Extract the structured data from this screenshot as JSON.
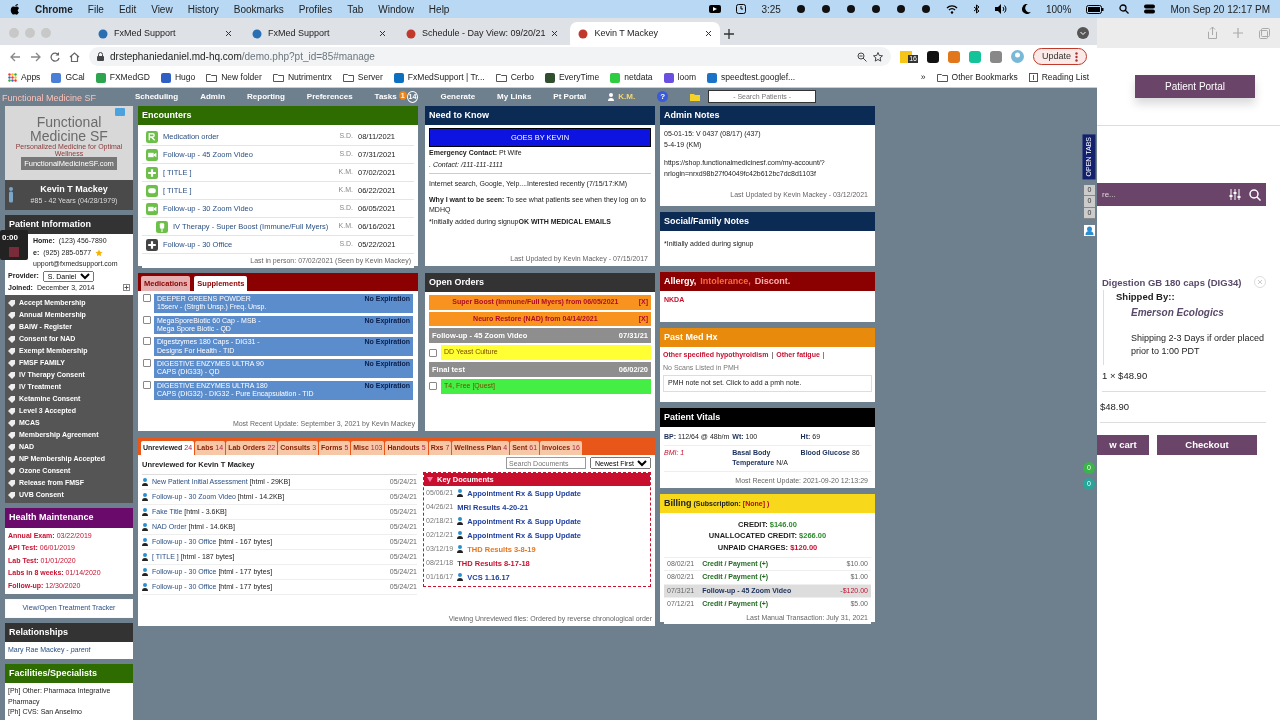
{
  "menubar": {
    "app": "Chrome",
    "menus": [
      "File",
      "Edit",
      "View",
      "History",
      "Bookmarks",
      "Profiles",
      "Tab",
      "Window",
      "Help"
    ],
    "timer": "3:25",
    "battery": "100%",
    "clock": "Mon Sep 20  12:17 PM"
  },
  "browser": {
    "tabs": [
      {
        "title": "FxMed Support",
        "selected": false
      },
      {
        "title": "FxMed Support",
        "selected": false
      },
      {
        "title": "Schedule - Day View: 09/20/21",
        "selected": false
      },
      {
        "title": "Kevin T Mackey",
        "selected": true
      }
    ],
    "address_host": "drstephaniedaniel.md-hq.com",
    "address_path": "/demo.php?pt_id=85#manage",
    "extension_badge": "16",
    "update": "Update",
    "bookmarks": [
      {
        "label": "Apps",
        "kind": "apps"
      },
      {
        "label": "GCal",
        "kind": "site",
        "color": "#4a7fd8"
      },
      {
        "label": "FXMedGD",
        "kind": "site",
        "color": "#2da44e"
      },
      {
        "label": "Hugo",
        "kind": "site",
        "color": "#2f5fc4"
      },
      {
        "label": "New folder",
        "kind": "folder"
      },
      {
        "label": "Nutrimentrx",
        "kind": "folder"
      },
      {
        "label": "Server",
        "kind": "folder"
      },
      {
        "label": "FxMedSupport | Tr...",
        "kind": "site",
        "color": "#0d6fbf"
      },
      {
        "label": "Cerbo",
        "kind": "folder"
      },
      {
        "label": "EveryTime",
        "kind": "site",
        "color": "#2f4f2f"
      },
      {
        "label": "netdata",
        "kind": "site",
        "color": "#2ecc40"
      },
      {
        "label": "loom",
        "kind": "site",
        "color": "#6b4fe0"
      },
      {
        "label": "speedtest.googlef...",
        "kind": "site",
        "color": "#1a73c8"
      }
    ],
    "more": "»",
    "other_bookmarks": "Other Bookmarks",
    "reading_list": "Reading List"
  },
  "app_nav": {
    "logo": "Functional Medicine SF",
    "items": [
      {
        "label": "Scheduling"
      },
      {
        "label": "Admin"
      },
      {
        "label": "Reporting"
      },
      {
        "label": "Preferences"
      },
      {
        "label": "Tasks",
        "badge": "1",
        "count": "14"
      },
      {
        "label": "Generate"
      },
      {
        "label": "My Links"
      },
      {
        "label": "Pt Portal"
      }
    ],
    "user": "K.M.",
    "help": "?",
    "search_placeholder": "- Search Patients -"
  },
  "recorder": {
    "time": "0:00"
  },
  "sidebar": {
    "logo_lines": [
      "Functional",
      "Medicine SF"
    ],
    "tagline": "Personalized Medicine for Optimal Wellness",
    "website": "FunctionalMedicineSF.com",
    "patient_name": "Kevin T Mackey",
    "patient_meta": "#85 - 42 Years (04/28/1979)",
    "info_title": "Patient Information",
    "info": [
      {
        "label": "Home:",
        "value": "(123) 456-7890",
        "starred": false
      },
      {
        "label": "e:",
        "value": "(925) 285-0577",
        "starred": true
      },
      {
        "value": "upport@fxmedsupport.com",
        "starred": false
      }
    ],
    "provider_label": "Provider:",
    "provider": "S. Daniel",
    "joined_label": "Joined:",
    "joined": "December 3, 2014",
    "forms": [
      "Accept Membership",
      "Annual Membership",
      "BAIW - Register",
      "Consent for NAD",
      "Exempt Membership",
      "FMSF FAMILY",
      "IV Therapy Consent",
      "IV Treatment",
      "Ketamine Consent",
      "Level 3 Accepted",
      "MCAS",
      "Membership Agreement",
      "NAD",
      "NP Membership Accepted",
      "Ozone Consent",
      "Release from FMSF",
      "UVB Consent"
    ],
    "health_title": "Health Maintenance",
    "health": [
      {
        "label": "Annual Exam:",
        "value": "03/22/2019"
      },
      {
        "label": "API Test:",
        "value": "06/01/2019"
      },
      {
        "label": "Lab Test:",
        "value": "01/01/2020"
      },
      {
        "label": "Labs in 8 weeks:",
        "value": "01/14/2020"
      },
      {
        "label": "Follow-up:",
        "value": "12/30/2020"
      }
    ],
    "tracker_button": "View/Open Treatment Tracker",
    "relationships_title": "Relationships",
    "relationships": [
      "Mary Rae Mackey - *parent*"
    ],
    "facilities_title": "Facilities/Specialists",
    "facilities": [
      "[Ph] Other: Pharmaca Integrative Pharmacy",
      "[Ph] CVS: San Anselmo"
    ]
  },
  "encounters": {
    "title": "Encounters",
    "rows": [
      {
        "kind": "rx",
        "title": "Medication order",
        "by": "S.D.",
        "date": "08/11/2021"
      },
      {
        "kind": "video",
        "title": "Follow-up - 45 Zoom Video",
        "by": "S.D.",
        "date": "07/31/2021"
      },
      {
        "kind": "plus",
        "title": "[ TITLE ]",
        "by": "K.M.",
        "date": "07/02/2021"
      },
      {
        "kind": "chat",
        "title": "[ TITLE ]",
        "by": "K.M.",
        "date": "06/22/2021"
      },
      {
        "kind": "video",
        "title": "Follow-up - 30 Zoom Video",
        "by": "S.D.",
        "date": "06/05/2021",
        "children": [
          {
            "kind": "iv",
            "title": "IV Therapy - Super Boost (Immune/Full Myers)",
            "by": "K.M.",
            "date": "06/16/2021"
          }
        ]
      },
      {
        "kind": "office",
        "title": "Follow-up - 30 Office",
        "by": "S.D.",
        "date": "05/22/2021"
      }
    ],
    "footer": "Last in person: 07/02/2021 (Seen by Kevin Mackey)"
  },
  "medications": {
    "tabs": [
      {
        "label": "Medications",
        "selected": false
      },
      {
        "label": "Supplements",
        "selected": true
      }
    ],
    "items": [
      {
        "name": "DEEPER GREENS POWDER",
        "detail": "15serv - (Strgth Unsp.) Freq. Unsp.",
        "expiry": "No Expiration",
        "checked": false
      },
      {
        "name": "MegaSporeBiotic 60 Cap - MSB -",
        "detail": "Mega Spore Biotic - QD",
        "expiry": "No Expiration",
        "checked": false
      },
      {
        "name": "Digestzymes 180 Caps - DIG31 -",
        "detail": "Designs For Health - TID",
        "expiry": "No Expiration",
        "checked": false
      },
      {
        "name": "DIGESTIVE ENZYMES ULTRA 90",
        "detail": "CAPS (DIG33) - QD",
        "expiry": "No Expiration",
        "checked": false
      },
      {
        "name": "DIGESTIVE ENZYMES ULTRA 180",
        "detail": "CAPS (DIG32) - DIG32 - Pure Encapsulation - TID",
        "expiry": "No Expiration",
        "checked": false
      }
    ],
    "footer": "Most Recent Update: September 3, 2021 by Kevin Mackey"
  },
  "need_to_know": {
    "title": "Need to Know",
    "banner": "GOES BY KEVIN",
    "emergency": "**Emergency Contact:**  Pt Wife",
    "contact": ". Contact: /111-111-1111",
    "source": "Internet search, Google, Yelp....Interested recently (7/15/17:KM)",
    "reason": "**Why I want to be seen:** To see what patients see when they log on to MDHQ",
    "signup": "*Initially added during signup",
    "signup_bold": "OK WITH MEDICAL EMAILS",
    "footer": "Last Updated by Kevin Mackey - 07/15/2017"
  },
  "admin_notes": {
    "title": "Admin Notes",
    "lines": [
      "05-01-15: V 0437 (08/17) (437)",
      "5-4-19 (KM)"
    ],
    "link": "https://shop.functionalmedicinesf.com/my-account/?nrlogin=nrxd98b27f04049fc42b612bc7dc8d1103f",
    "footer": "Last Updated by Kevin Mackey - 03/12/2021"
  },
  "social_notes": {
    "title": "Social/Family Notes",
    "text": "*Initially added during signup"
  },
  "open_orders": {
    "title": "Open Orders",
    "orders": [
      {
        "title": "Super Boost (Immune/Full Myers) from 06/05/2021",
        "close": "[X]"
      },
      {
        "title": "Neuro Restore (NAD) from 04/14/2021",
        "close": "[X]"
      }
    ],
    "groups": [
      {
        "title": "Follow-up - 45 Zoom Video",
        "date": "07/31/21",
        "items": [
          {
            "label": "DD Yeast Culture",
            "color": "#ffff33",
            "checked": false
          }
        ]
      },
      {
        "title": "Final test",
        "date": "06/02/20",
        "items": [
          {
            "label": "T4, Free [Quest]",
            "color": "#44ee44",
            "checked": false
          }
        ]
      }
    ]
  },
  "allergy": {
    "title_parts": [
      {
        "text": "Allergy,",
        "color": "#ffffff"
      },
      {
        "text": "Intolerance,",
        "color": "#ff6a3d"
      },
      {
        "text": "Discont.",
        "color": "#ffb0b0"
      }
    ],
    "text": "NKDA"
  },
  "past_med_hx": {
    "title": "Past Med Hx",
    "diagnoses": [
      "Other specified hypothyroidism",
      "Other fatigue"
    ],
    "separator": "|",
    "scans": "No Scans Listed in PMH",
    "note": "PMH note not set. Click to add a pmh note."
  },
  "vitals": {
    "title": "Patient Vitals",
    "rows": [
      [
        {
          "label": "BP:",
          "value": "112/64 @ 48b/m",
          "alert": false
        },
        {
          "label": "Wt:",
          "value": "100",
          "alert": false
        },
        {
          "label": "Ht:",
          "value": "69",
          "alert": false
        }
      ],
      [
        {
          "label": "BMI: 1",
          "alert": true
        },
        {
          "label": "Basal Body Temperature",
          "value": "N/A",
          "alert": false
        },
        {
          "label": "Blood Glucose",
          "value": "86",
          "alert": false
        }
      ]
    ],
    "footer": "Most Recent Update: 2021-09-20 12:13:29"
  },
  "billing": {
    "title": "Billing",
    "subscription_label": "(Subscription:",
    "subscription_value": "[None] )",
    "totals": [
      {
        "label": "CREDIT:",
        "value": "$146.00",
        "due": false
      },
      {
        "label": "UNALLOCATED CREDIT:",
        "value": "$266.00",
        "due": false
      },
      {
        "label": "UNPAID CHARGES:",
        "value": "$120.00",
        "due": true
      }
    ],
    "transactions": [
      {
        "date": "08/02/21",
        "desc": "Credit / Payment (+)",
        "amount": "$10.00",
        "highlighted": false
      },
      {
        "date": "08/02/21",
        "desc": "Credit / Payment (+)",
        "amount": "$1.00",
        "highlighted": false
      },
      {
        "date": "07/31/21",
        "desc": "Follow-up - 45 Zoom Video",
        "amount": "-$120.00",
        "highlighted": true
      },
      {
        "date": "07/12/21",
        "desc": "Credit / Payment (+)",
        "amount": "$5.00",
        "highlighted": false
      }
    ],
    "footer": "Last Manual Transaction: July 31, 2021"
  },
  "documents": {
    "tabs": [
      {
        "label": "Unreviewed",
        "count": "24",
        "selected": true
      },
      {
        "label": "Labs",
        "count": "14",
        "selected": false
      },
      {
        "label": "Lab Orders",
        "count": "22",
        "selected": false
      },
      {
        "label": "Consults",
        "count": "3",
        "selected": false
      },
      {
        "label": "Forms",
        "count": "5",
        "selected": false
      },
      {
        "label": "Misc",
        "count": "103",
        "selected": false
      },
      {
        "label": "Handouts",
        "count": "5",
        "selected": false
      },
      {
        "label": "Rxs",
        "count": "7",
        "selected": false
      },
      {
        "label": "Wellness Plan",
        "count": "4",
        "selected": false
      },
      {
        "label": "Sent",
        "count": "61",
        "selected": false
      },
      {
        "label": "Invoices",
        "count": "16",
        "selected": false
      }
    ],
    "heading": "Unreviewed for Kevin T Mackey",
    "search_placeholder": "Search Documents",
    "sort": "Newest First",
    "rows": [
      {
        "title": "New Patient Initial Assessment",
        "meta": "[html - 29KB]",
        "date": "05/24/21"
      },
      {
        "title": "Follow-up - 30 Zoom Video",
        "meta": "[html - 14.2KB]",
        "date": "05/24/21"
      },
      {
        "title": "Fake Title",
        "meta": "[html - 3.6KB]",
        "date": "05/24/21"
      },
      {
        "title": "NAD Order",
        "meta": "[html - 14.6KB]",
        "date": "05/24/21"
      },
      {
        "title": "Follow-up - 30 Office",
        "meta": "[html - 167 bytes]",
        "date": "05/24/21"
      },
      {
        "title": "[ TITLE ]",
        "meta": "[html - 187 bytes]",
        "date": "05/24/21"
      },
      {
        "title": "Follow-up - 30 Office",
        "meta": "[html - 177 bytes]",
        "date": "05/24/21"
      },
      {
        "title": "Follow-up - 30 Office",
        "meta": "[html - 177 bytes]",
        "date": "05/24/21"
      }
    ],
    "key_title": "Key Documents",
    "key_docs": [
      {
        "date": "05/06/21",
        "title": "Appointment Rx & Supp Update",
        "color": "#1f3f9f",
        "icon": true
      },
      {
        "date": "04/26/21",
        "title": "MRI Results 4-20-21",
        "color": "#1f3f9f",
        "icon": false
      },
      {
        "date": "02/18/21",
        "title": "Appointment Rx & Supp Update",
        "color": "#1f3f9f",
        "icon": true
      },
      {
        "date": "02/12/21",
        "title": "Appointment Rx & Supp Update",
        "color": "#1f3f9f",
        "icon": true
      },
      {
        "date": "03/12/19",
        "title": "THD Results 3-8-19",
        "color": "#e8741a",
        "icon": true
      },
      {
        "date": "08/21/18",
        "title": "THD Results 8-17-18",
        "color": "#c8102e",
        "icon": false
      },
      {
        "date": "01/16/17",
        "title": "VCS 1.16.17",
        "color": "#1f3f9f",
        "icon": true
      }
    ],
    "footer": "Viewing Unreviewed files: Ordered by reverse chronological order"
  },
  "side_tabs": {
    "label": "OPEN TABS",
    "counters": [
      "0",
      "0",
      "0"
    ],
    "bubbles": [
      {
        "text": "0",
        "color": "#3cb44b"
      },
      {
        "text": "0",
        "color": "#2aa59a"
      }
    ]
  },
  "portal": {
    "button": "Patient Portal",
    "search_placeholder": "re...",
    "product": "Digestion GB 180 caps (DIG34)",
    "shipped_by": "Shipped By::",
    "vendor": "Emerson Ecologics",
    "shipping_note": "Shipping  2-3 Days if order placed prior to 1:00 PDT",
    "quantity_price": "1 × $48.90",
    "subtotal": "$48.90",
    "buttons": [
      "w cart",
      "Checkout"
    ]
  }
}
